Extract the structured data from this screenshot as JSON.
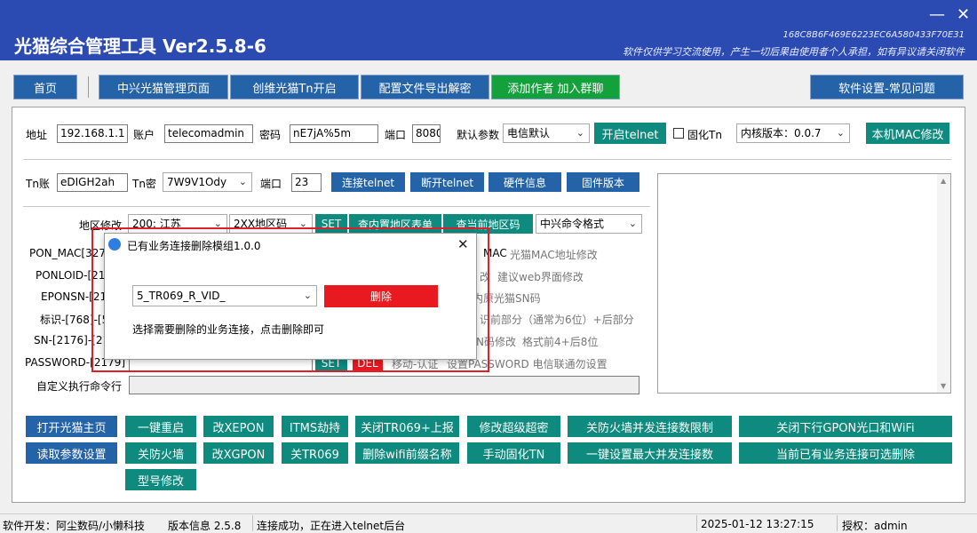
{
  "app": {
    "title": "光猫综合管理工具 Ver2.5.8-6",
    "hash": "168C8B6F469E6223EC6A580433F70E31",
    "disclaimer": "软件仅供学习交流使用，产生一切后果由使用者个人承担，如有异议请关闭软件",
    "minimize": "—",
    "close": "✕"
  },
  "nav": {
    "home": "首页",
    "zte": "中兴光猫管理页面",
    "chuangwei": "创维光猫Tn开启",
    "config_export": "配置文件导出解密",
    "add_author": "添加作者 加入群聊",
    "settings": "软件设置-常见问题"
  },
  "conn": {
    "addr_label": "地址",
    "addr_value": "192.168.1.1",
    "account_label": "账户",
    "account_value": "telecomadmin",
    "password_label": "密码",
    "password_value": "nE7jA%5m",
    "port_label": "端口",
    "port_value": "8080",
    "default_label": "默认参数",
    "default_value": "电信默认",
    "open_telnet": "开启telnet",
    "fix_tn": "固化Tn",
    "kernel": "内核版本：0.0.7",
    "mac_modify": "本机MAC修改"
  },
  "tn": {
    "account_label": "Tn账",
    "account_value": "eDIGH2ah",
    "password_label": "Tn密",
    "password_value": "7W9V1Ody",
    "port_label": "端口",
    "port_value": "23",
    "connect": "连接telnet",
    "disconnect": "断开telnet",
    "hardware": "硬件信息",
    "firmware": "固件版本"
  },
  "region": {
    "label": "地区修改",
    "region_value": "200: 江苏",
    "region_code": "2XX地区码",
    "set": "SET",
    "query_list": "查内置地区表单",
    "query_current": "查当前地区码",
    "cmd_format": "中兴命令格式"
  },
  "params": [
    {
      "label": "PON_MAC[327",
      "tail": "MAC",
      "hint": "光猫MAC地址修改"
    },
    {
      "label": "PONLOID-[21",
      "tail": "改",
      "hint": "建议web界面修改"
    },
    {
      "label": "EPONSN-[21",
      "tail": "内原光猫SN码",
      "hint": ""
    },
    {
      "label": "标识-[768]-[5",
      "tail": "识前部分（通常为6位）+后部分",
      "hint": ""
    },
    {
      "label": "SN-[2176]-[21",
      "tail": "N码修改",
      "hint": "格式前4+后8位"
    },
    {
      "label": "PASSWORD-[2179]",
      "tail": "",
      "hint": "设置PASSWORD 电信联通勿设置"
    }
  ],
  "password_row": {
    "set": "SET",
    "del": "DEL",
    "mobile": "移动-认证"
  },
  "custom_cmd_label": "自定义执行命令行",
  "actions": {
    "open_home": "打开光猫主页",
    "read_params": "读取参数设置",
    "reboot": "一键重启",
    "close_fw": "关防火墙",
    "model_modify": "型号修改",
    "xepon": "改XEPON",
    "xgpon": "改XGPON",
    "itms": "ITMS劫持",
    "close_tr069": "关TR069",
    "close_tr069_report": "关闭TR069+上报",
    "delete_wifi_prefix": "删除wifi前缀名称",
    "super_pwd": "修改超级超密",
    "manual_fix_tn": "手动固化TN",
    "fw_limit": "关防火墙并发连接数限制",
    "max_conn": "一键设置最大并发连接数",
    "close_gpon_wifi": "关闭下行GPON光口和WiFi",
    "delete_connections": "当前已有业务连接可选删除"
  },
  "dialog": {
    "title": "已有业务连接删除模组1.0.0",
    "close": "✕",
    "select_value": "5_TR069_R_VID_",
    "delete": "删除",
    "hint": "选择需要删除的业务连接，点击删除即可"
  },
  "status": {
    "developer": "软件开发：阿尘数码/小懒科技",
    "version": "版本信息  2.5.8",
    "message": "连接成功，正在进入telnet后台",
    "datetime": "2025-01-12 13:27:15",
    "auth": "授权：admin"
  },
  "colors": {
    "titlebar": "#2b4bb3",
    "nav_blue": "#2563a8",
    "teal": "#0e8a7e",
    "green": "#12a13a",
    "red": "#e8191f"
  }
}
